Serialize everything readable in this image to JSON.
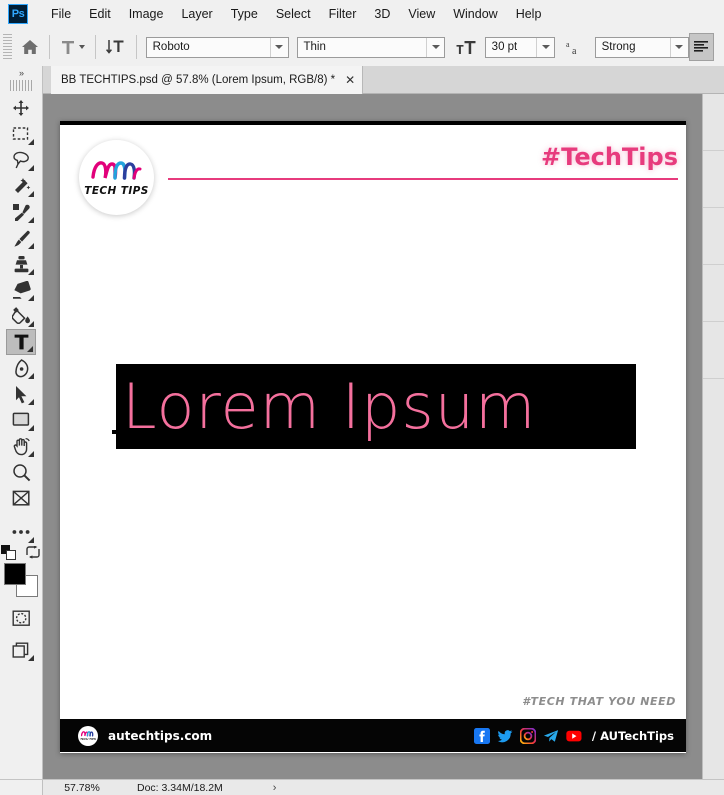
{
  "app": {
    "logo_text": "Ps"
  },
  "menubar": {
    "items": [
      {
        "label": "File"
      },
      {
        "label": "Edit"
      },
      {
        "label": "Image"
      },
      {
        "label": "Layer"
      },
      {
        "label": "Type"
      },
      {
        "label": "Select"
      },
      {
        "label": "Filter"
      },
      {
        "label": "3D"
      },
      {
        "label": "View"
      },
      {
        "label": "Window"
      },
      {
        "label": "Help"
      }
    ]
  },
  "optionsbar": {
    "home_icon": "home-icon",
    "tool_preset_icon": "type-tool-icon",
    "orientation_icon": "toggle-text-orientation-icon",
    "font_family": "Roboto",
    "font_style": "Thin",
    "font_size": "30 pt",
    "antialias_icon": "anti-aliasing-icon",
    "antialias": "Strong",
    "align_icon": "paragraph-panel-icon"
  },
  "toolbar": {
    "expand_chevron": "»",
    "tools": [
      {
        "name": "move-tool",
        "icon": "move-icon",
        "has_flyout": false,
        "active": false
      },
      {
        "name": "rectangular-marquee-tool",
        "icon": "marquee-icon",
        "has_flyout": true,
        "active": false
      },
      {
        "name": "lasso-tool",
        "icon": "lasso-icon",
        "has_flyout": true,
        "active": false
      },
      {
        "name": "magic-wand-tool",
        "icon": "magic-wand-icon",
        "has_flyout": true,
        "active": false
      },
      {
        "name": "eyedropper-tool",
        "icon": "eyedropper-icon",
        "has_flyout": true,
        "active": false
      },
      {
        "name": "brush-tool",
        "icon": "brush-icon",
        "has_flyout": true,
        "active": false
      },
      {
        "name": "clone-stamp-tool",
        "icon": "clone-stamp-icon",
        "has_flyout": true,
        "active": false
      },
      {
        "name": "eraser-tool",
        "icon": "eraser-icon",
        "has_flyout": true,
        "active": false
      },
      {
        "name": "paint-bucket-tool",
        "icon": "paint-bucket-icon",
        "has_flyout": true,
        "active": false
      },
      {
        "name": "type-tool",
        "icon": "type-icon",
        "has_flyout": true,
        "active": true
      },
      {
        "name": "pen-tool",
        "icon": "pen-icon",
        "has_flyout": true,
        "active": false
      },
      {
        "name": "path-selection-tool",
        "icon": "arrow-pointer-icon",
        "has_flyout": true,
        "active": false
      },
      {
        "name": "rectangle-tool",
        "icon": "rectangle-icon",
        "has_flyout": true,
        "active": false
      },
      {
        "name": "hand-tool",
        "icon": "hand-icon",
        "has_flyout": true,
        "active": false
      },
      {
        "name": "zoom-tool",
        "icon": "magnifier-icon",
        "has_flyout": false,
        "active": false
      },
      {
        "name": "frame-tool",
        "icon": "frame-icon",
        "has_flyout": false,
        "active": false
      },
      {
        "name": "edit-toolbar",
        "icon": "ellipsis-icon",
        "has_flyout": true,
        "active": false
      }
    ],
    "default_colors_icon": "default-colors-icon",
    "swap_colors_icon": "swap-colors-icon",
    "foreground_color": "#000000",
    "background_color": "#ffffff",
    "quick_mask_icon": "quick-mask-icon",
    "screen_mode_icon": "screen-mode-icon"
  },
  "document_tab": {
    "title": "BB TECHTIPS.psd @ 57.8% (Lorem Ipsum, RGB/8) *",
    "close_label": "✕"
  },
  "canvas": {
    "logo": {
      "word": "TECH TIPS",
      "alt": "au-tech-tips-logo"
    },
    "hashtag": "#TechTips",
    "hashtag_color": "#e73b7d",
    "rule_color": "#e73b7d",
    "selected_text": "Lorem Ipsum",
    "selected_text_color": "#f4709d",
    "selection_bg": "#000000",
    "slogan": "#TECH THAT YOU NEED",
    "footer": {
      "website": "autechtips.com",
      "handle": "/ AUTechTips",
      "socials": [
        {
          "name": "facebook-icon"
        },
        {
          "name": "twitter-icon"
        },
        {
          "name": "instagram-icon"
        },
        {
          "name": "telegram-icon"
        },
        {
          "name": "youtube-icon"
        }
      ]
    }
  },
  "statusbar": {
    "zoom": "57.78%",
    "doc_info": "Doc: 3.34M/18.2M",
    "arrow": "›"
  }
}
